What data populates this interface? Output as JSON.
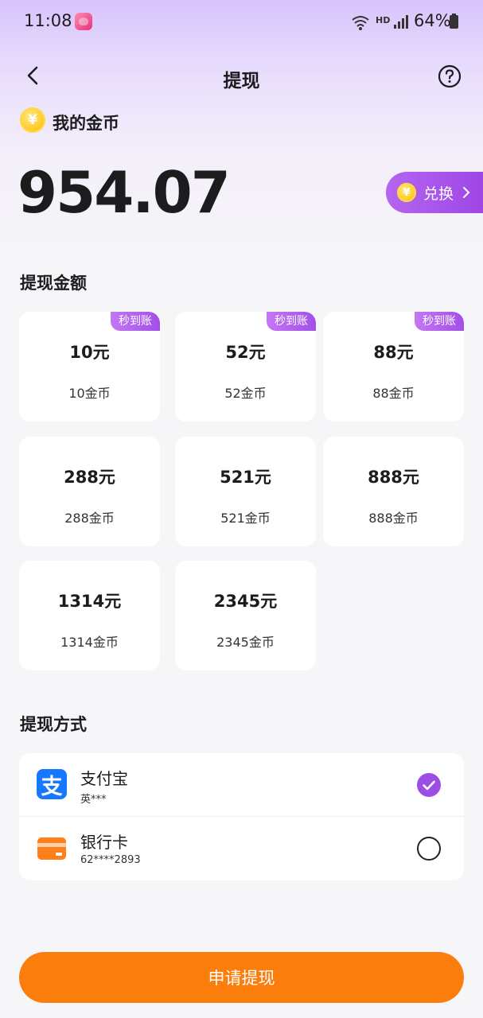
{
  "status_bar": {
    "time": "11:08",
    "network": "HD",
    "battery": "64%"
  },
  "header": {
    "title": "提现"
  },
  "balance": {
    "coin_symbol": "¥",
    "label": "我的金币",
    "amount": "954.07",
    "exchange_label": "兑换"
  },
  "amount_section": {
    "title": "提现金额",
    "options": [
      {
        "yuan": "10元",
        "coins": "10金币",
        "badge": "秒到账"
      },
      {
        "yuan": "52元",
        "coins": "52金币",
        "badge": "秒到账"
      },
      {
        "yuan": "88元",
        "coins": "88金币",
        "badge": "秒到账"
      },
      {
        "yuan": "288元",
        "coins": "288金币"
      },
      {
        "yuan": "521元",
        "coins": "521金币"
      },
      {
        "yuan": "888元",
        "coins": "888金币"
      },
      {
        "yuan": "1314元",
        "coins": "1314金币"
      },
      {
        "yuan": "2345元",
        "coins": "2345金币"
      }
    ]
  },
  "method_section": {
    "title": "提现方式",
    "methods": [
      {
        "name": "支付宝",
        "account": "英***",
        "icon_text": "支",
        "selected": true
      },
      {
        "name": "银行卡",
        "account": "62****2893",
        "selected": false
      }
    ]
  },
  "submit_label": "申请提现",
  "colors": {
    "accent_purple": "#9b4ee6",
    "submit_orange": "#fb7d0b",
    "alipay_blue": "#1677ff",
    "bank_orange": "#ff7f1a"
  }
}
